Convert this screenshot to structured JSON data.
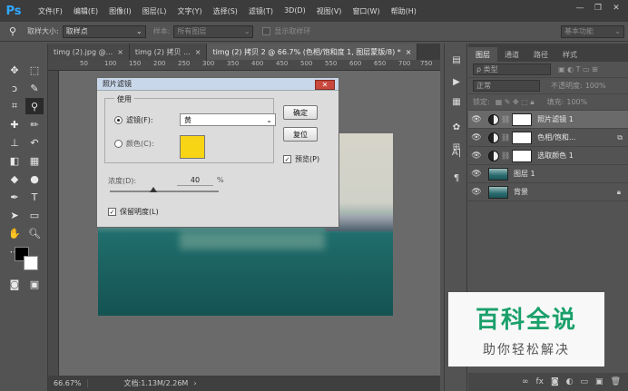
{
  "app": {
    "logo": "Ps",
    "accent": "#31a8ff"
  },
  "menu": [
    "文件(F)",
    "编辑(E)",
    "图像(I)",
    "图层(L)",
    "文字(Y)",
    "选择(S)",
    "滤镜(T)",
    "3D(D)",
    "视图(V)",
    "窗口(W)",
    "帮助(H)"
  ],
  "window_controls": [
    "—",
    "❐",
    "✕"
  ],
  "options": {
    "sample_size_label": "取样大小:",
    "sample_size_value": "取样点",
    "sample_label": "样本:",
    "sample_value": "所有图层",
    "show_ring_label": "显示取样环",
    "workspace": "基本功能"
  },
  "tabs": [
    {
      "label": "timg (2).jpg @...",
      "close": "×"
    },
    {
      "label": "timg (2) 拷贝 ...",
      "close": "×"
    },
    {
      "label": "timg (2) 拷贝 2 @ 66.7% (色相/饱和度 1, 图层蒙版/8) *",
      "close": "×"
    }
  ],
  "ruler_numbers": [
    "50",
    "100",
    "150",
    "200",
    "250",
    "300",
    "350",
    "400",
    "450",
    "500",
    "550",
    "600",
    "650",
    "700",
    "750"
  ],
  "status": {
    "zoom": "66.67%",
    "doc": "文档:1.13M/2.26M"
  },
  "dialog": {
    "title": "照片滤镜",
    "close": "✕",
    "use_legend": "使用",
    "filter_label": "滤镜(F):",
    "filter_value": "黄",
    "color_label": "颜色(C):",
    "color_swatch": "#f7d515",
    "ok_label": "确定",
    "reset_label": "复位",
    "preview_label": "预览(P)",
    "preview_checked": true,
    "density_label": "浓度(D):",
    "density_value": "40",
    "density_unit": "%",
    "preserve_label": "保留明度(L)",
    "preserve_checked": true
  },
  "layers_panel": {
    "tabs": [
      "图层",
      "通道",
      "路径",
      "样式"
    ],
    "search_placeholder": "ρ 类型",
    "blend_mode": "正常",
    "opacity_label": "不透明度:",
    "opacity_value": "100%",
    "lock_label": "锁定:",
    "fill_label": "填充:",
    "fill_value": "100%",
    "layers": [
      {
        "name": "照片滤镜 1",
        "kind": "adjustment",
        "selected": true
      },
      {
        "name": "色相/饱和...",
        "kind": "adjustment",
        "selected": false
      },
      {
        "name": "选取颜色 1",
        "kind": "adjustment",
        "selected": false
      },
      {
        "name": "图层 1",
        "kind": "pixel",
        "selected": false
      },
      {
        "name": "背景",
        "kind": "background",
        "selected": false
      }
    ],
    "footer_icons": [
      "∞",
      "fx",
      "◙",
      "◐",
      "▭",
      "▣",
      "🗑"
    ]
  },
  "watermark": {
    "title": "百科全说",
    "subtitle": "助你轻松解决",
    "color": "#1aa06a"
  }
}
